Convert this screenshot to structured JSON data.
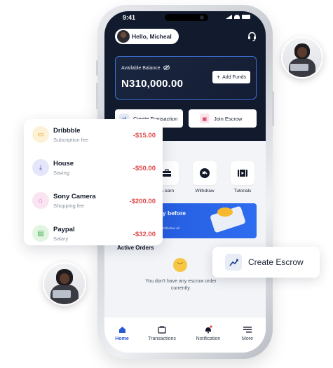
{
  "status_bar": {
    "time": "9:41"
  },
  "header": {
    "greeting": "Hello, Micheal"
  },
  "balance": {
    "label": "Available Balance",
    "value": "N310,000.00",
    "add_funds": "Add Funds"
  },
  "actions": {
    "create_transaction": "Create Transaction",
    "join_escrow": "Join Escrow"
  },
  "quick_actions": [
    {
      "label": "r & earn",
      "icon": "briefcase-icon"
    },
    {
      "label": "Withdraw",
      "icon": "withdraw-icon"
    },
    {
      "label": "Tutorials",
      "icon": "video-icon"
    }
  ],
  "promo": {
    "title_line1": "pay before",
    "title_line2": "s.",
    "subtitle": "ct Satisfaction all"
  },
  "orders": {
    "title": "Active Orders",
    "empty_text": "You don't have any escrow order currently."
  },
  "bottom_nav": [
    {
      "label": "Home",
      "active": true
    },
    {
      "label": "Transactions",
      "active": false
    },
    {
      "label": "Notification",
      "active": false
    },
    {
      "label": "More",
      "active": false
    }
  ],
  "transactions": [
    {
      "name": "Dribbble",
      "subtitle": "Subcription fee",
      "amount": "-$15.00",
      "icon_color": "#fdf2d6",
      "icon_fg": "#e0a43a"
    },
    {
      "name": "House",
      "subtitle": "Saving",
      "amount": "-$50.00",
      "icon_color": "#e6e6fb",
      "icon_fg": "#5b5bd6"
    },
    {
      "name": "Sony Camera",
      "subtitle": "Shopping fee",
      "amount": "-$200.00",
      "icon_color": "#fbe4f2",
      "icon_fg": "#d963a8"
    },
    {
      "name": "Paypal",
      "subtitle": "Salary",
      "amount": "-$32.00",
      "icon_color": "#e2f5e2",
      "icon_fg": "#3fae4b"
    }
  ],
  "escrow_pill": {
    "label": "Create Escrow"
  },
  "colors": {
    "accent": "#2a5bd7",
    "dark_bg": "#121b2e",
    "negative": "#e04848"
  }
}
